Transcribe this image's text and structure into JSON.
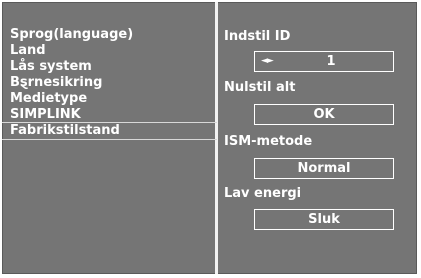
{
  "menu": {
    "items": [
      {
        "label": "Sprog(language)"
      },
      {
        "label": "Land"
      },
      {
        "label": "Lås system"
      },
      {
        "label": "Bȿrnesikring"
      },
      {
        "label": "Medietype"
      },
      {
        "label": "SIMPLINK"
      },
      {
        "label": "Fabrikstilstand",
        "selected": true
      }
    ]
  },
  "settings": {
    "indstil_id": {
      "label": "Indstil ID",
      "value": "1",
      "arrows": "◄►"
    },
    "nulstil_alt": {
      "label": "Nulstil alt",
      "value": "OK"
    },
    "ism_metode": {
      "label": "ISM-metode",
      "value": "Normal"
    },
    "lav_energi": {
      "label": "Lav energi",
      "value": "Sluk"
    }
  },
  "colors": {
    "panel_background": "#757575",
    "text": "#ffffff",
    "divider": "#f2f2f2"
  }
}
